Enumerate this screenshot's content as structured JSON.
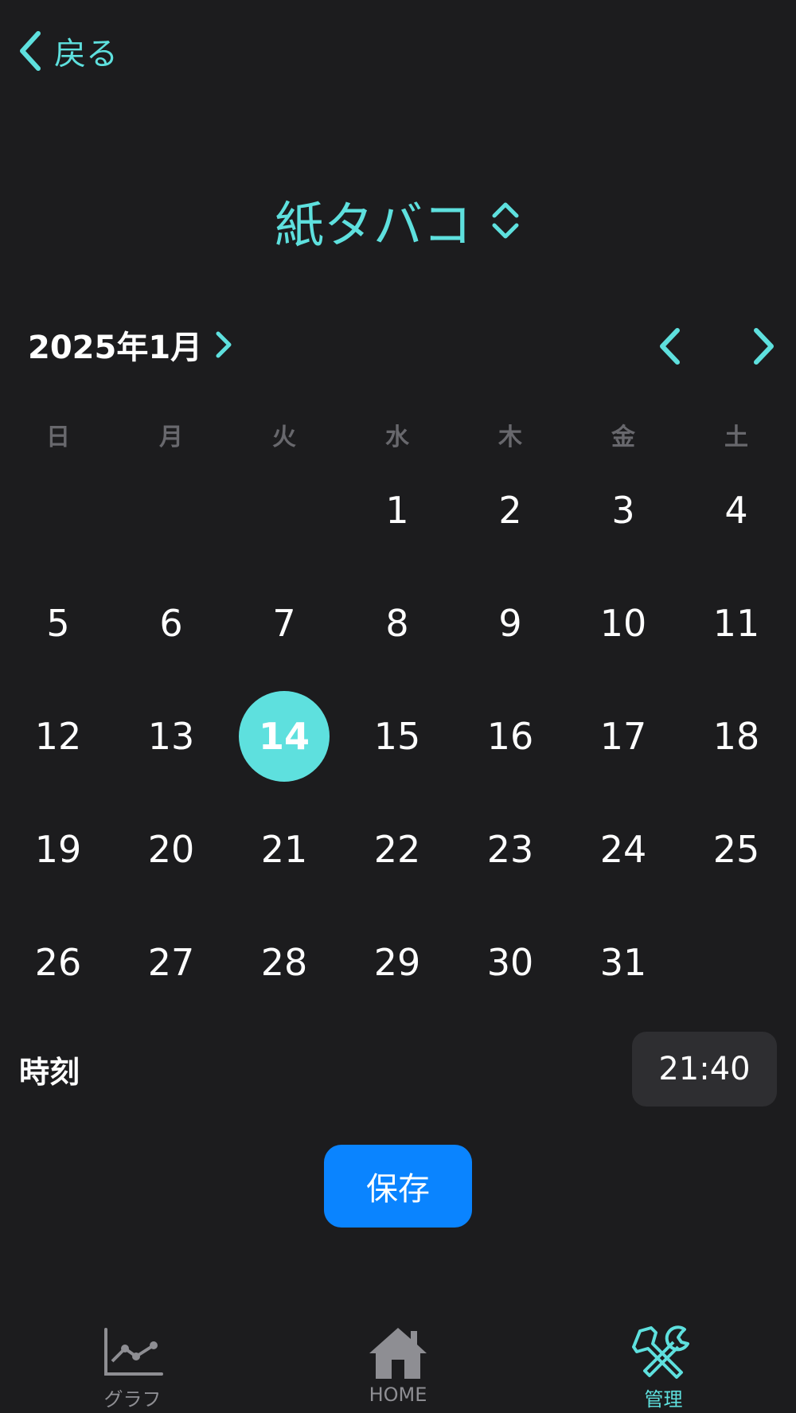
{
  "header": {
    "back_label": "戻る"
  },
  "title": "紙タバコ",
  "calendar": {
    "month_label": "2025年1月",
    "weekdays": [
      "日",
      "月",
      "火",
      "水",
      "木",
      "金",
      "土"
    ],
    "days": [
      "",
      "",
      "",
      "1",
      "2",
      "3",
      "4",
      "5",
      "6",
      "7",
      "8",
      "9",
      "10",
      "11",
      "12",
      "13",
      "14",
      "15",
      "16",
      "17",
      "18",
      "19",
      "20",
      "21",
      "22",
      "23",
      "24",
      "25",
      "26",
      "27",
      "28",
      "29",
      "30",
      "31",
      ""
    ],
    "selected_day": "14"
  },
  "time": {
    "label": "時刻",
    "value": "21:40"
  },
  "save_label": "保存",
  "tabs": [
    {
      "label": "グラフ",
      "icon": "chart-icon",
      "active": false
    },
    {
      "label": "HOME",
      "icon": "home-icon",
      "active": false
    },
    {
      "label": "管理",
      "icon": "tools-icon",
      "active": true
    }
  ],
  "colors": {
    "accent": "#5ee0de",
    "background": "#1c1c1e",
    "button": "#0a84ff",
    "time_bg": "#2e2e31"
  }
}
